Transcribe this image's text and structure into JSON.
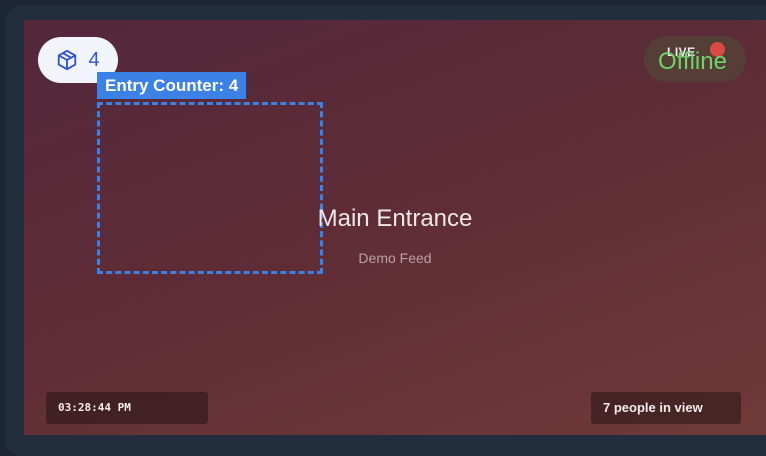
{
  "counter_badge": {
    "icon": "cube-icon",
    "count": "4"
  },
  "zone": {
    "label": "Entry Counter: 4",
    "color": "#3c82e6"
  },
  "status": {
    "live": "LIVE",
    "state": "Offline",
    "state_color": "#6fd36b",
    "dot_color": "#d84a44"
  },
  "feed": {
    "title": "Main Entrance",
    "subtitle": "Demo Feed"
  },
  "footer": {
    "time": "03:28:44 PM",
    "people": "7 people in view"
  }
}
